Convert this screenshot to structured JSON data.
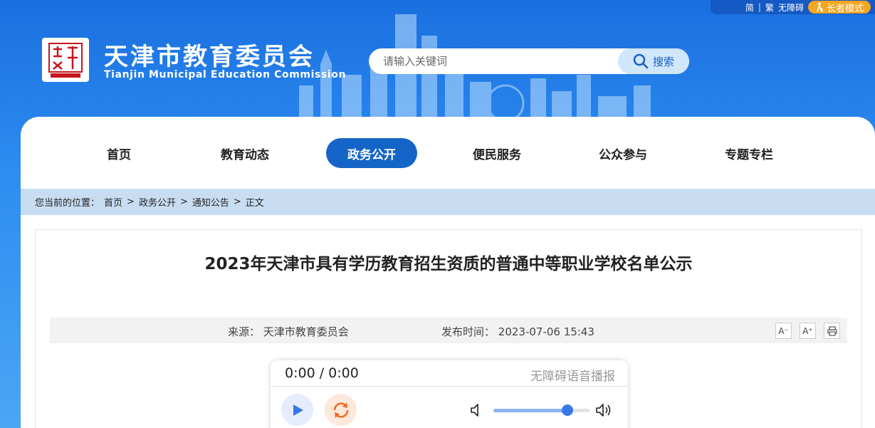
{
  "topbar": {
    "simplified": "简",
    "separator": "|",
    "traditional": "繁",
    "accessibility": "无障碍",
    "elder_mode": "长者模式"
  },
  "site": {
    "title": "天津市教育委员会",
    "subtitle": "Tianjin Municipal Education Commission"
  },
  "search": {
    "placeholder": "请输入关键词",
    "button": "搜索"
  },
  "nav": {
    "items": [
      {
        "label": "首页",
        "active": false
      },
      {
        "label": "教育动态",
        "active": false
      },
      {
        "label": "政务公开",
        "active": true
      },
      {
        "label": "便民服务",
        "active": false
      },
      {
        "label": "公众参与",
        "active": false
      },
      {
        "label": "专题专栏",
        "active": false
      }
    ]
  },
  "breadcrumb": {
    "prefix": "您当前的位置：",
    "items": [
      "首页",
      "政务公开",
      "通知公告",
      "正文"
    ],
    "separator": ">"
  },
  "article": {
    "title": "2023年天津市具有学历教育招生资质的普通中等职业学校名单公示",
    "source_label": "来源：",
    "source": "天津市教育委员会",
    "time_label": "发布时间：",
    "time": "2023-07-06 15:43"
  },
  "tools": {
    "font_decrease": "A⁻",
    "font_increase": "A⁺",
    "print_icon": "print-icon"
  },
  "player": {
    "time": "0:00 / 0:00",
    "label": "无障碍语音播报",
    "volume": 0.77
  },
  "colors": {
    "header_blue": "#2d8df0",
    "nav_active": "#1565c8",
    "breadcrumb_bg": "#c8ddf2",
    "elder_orange": "#f5a623"
  }
}
